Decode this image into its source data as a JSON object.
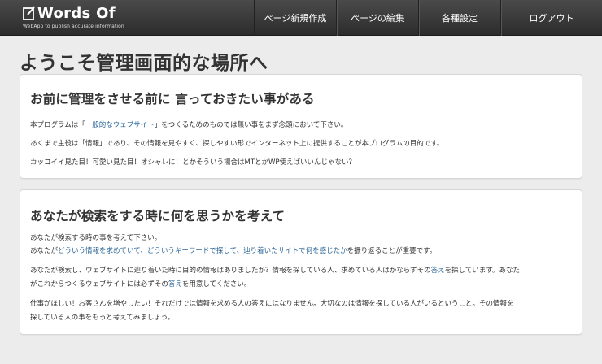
{
  "brand": {
    "name": "Words Of",
    "tagline": "WebApp to publish accurate information"
  },
  "nav": [
    {
      "label": "ページ新規作成"
    },
    {
      "label": "ページの編集"
    },
    {
      "label": "各種設定"
    },
    {
      "label": "ログアウト"
    }
  ],
  "page_title": "ようこそ管理画面的な場所へ",
  "panel1": {
    "heading": "お前に管理をさせる前に 言っておきたい事がある",
    "line1": {
      "a": "本プログラムは「",
      "b": "一般的なウェブサイト",
      "c": "」をつくるためのものでは無い事をまず念頭において下さい。"
    },
    "line2": "あくまで主役は「情報」であり、その情報を見やすく、探しやすい形でインターネット上に提供することが本プログラムの目的です。",
    "line3": "カッコイイ見た目！可愛い見た目！オシャレに！とかそういう場合はMTとかWP使えばいいんじゃない？"
  },
  "panel2": {
    "heading": "あなたが検索をする時に何を思うかを考えて",
    "line1": "あなたが検索する時の事を考えて下さい。",
    "line2": {
      "a": "あなたが",
      "b": "どういう情報を求めていて、どういうキーワードで探して、辿り着いたサイトで何を感じたか",
      "c": "を振り返ることが重要です。"
    },
    "line3": {
      "a": "あなたが検索し、ウェブサイトに辿り着いた時に目的の情報はありましたか？情報を探している人、求めている人はかならずその",
      "b": "答え",
      "c": "を探しています。あなた"
    },
    "line4": {
      "a": "がこれからつくるウェブサイトには必ずその",
      "b": "答え",
      "c": "を用意してください。"
    },
    "line5": "仕事がほしい！お客さんを増やしたい！それだけでは情報を求める人の答えにはなりません。大切なのは情報を探している人がいるということ。その情報を",
    "line6": "探している人の事をもっと考えてみましょう。"
  },
  "colors": {
    "navbar": "#3a3a3a",
    "background": "#ececec",
    "link": "#2a6496"
  }
}
